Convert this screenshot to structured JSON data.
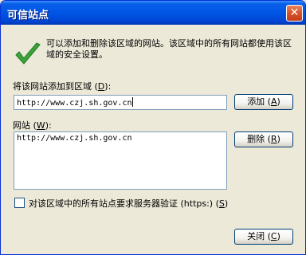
{
  "window": {
    "title": "可信站点",
    "close_glyph": "✕"
  },
  "description": "可以添加和删除该区域的网站。该区域中的所有网站都使用该区域的安全设置。",
  "add_field": {
    "label": "将该网站添加到区域 (",
    "label_key": "D",
    "label_end": "):",
    "value": "http://www.czj.sh.gov.cn"
  },
  "buttons": {
    "add": {
      "label": "添加 (",
      "key": "A",
      "end": ")"
    },
    "remove": {
      "label": "删除 (",
      "key": "R",
      "end": ")"
    },
    "close": {
      "label": "关闭 (",
      "key": "C",
      "end": ")"
    }
  },
  "websites": {
    "label": "网站 (",
    "label_key": "W",
    "label_end": "):",
    "items": [
      "http://www.czj.sh.gov.cn"
    ]
  },
  "https_option": {
    "label": "对该区域中的所有站点要求服务器验证 (https:) (",
    "key": "S",
    "end": ")",
    "checked": false
  }
}
